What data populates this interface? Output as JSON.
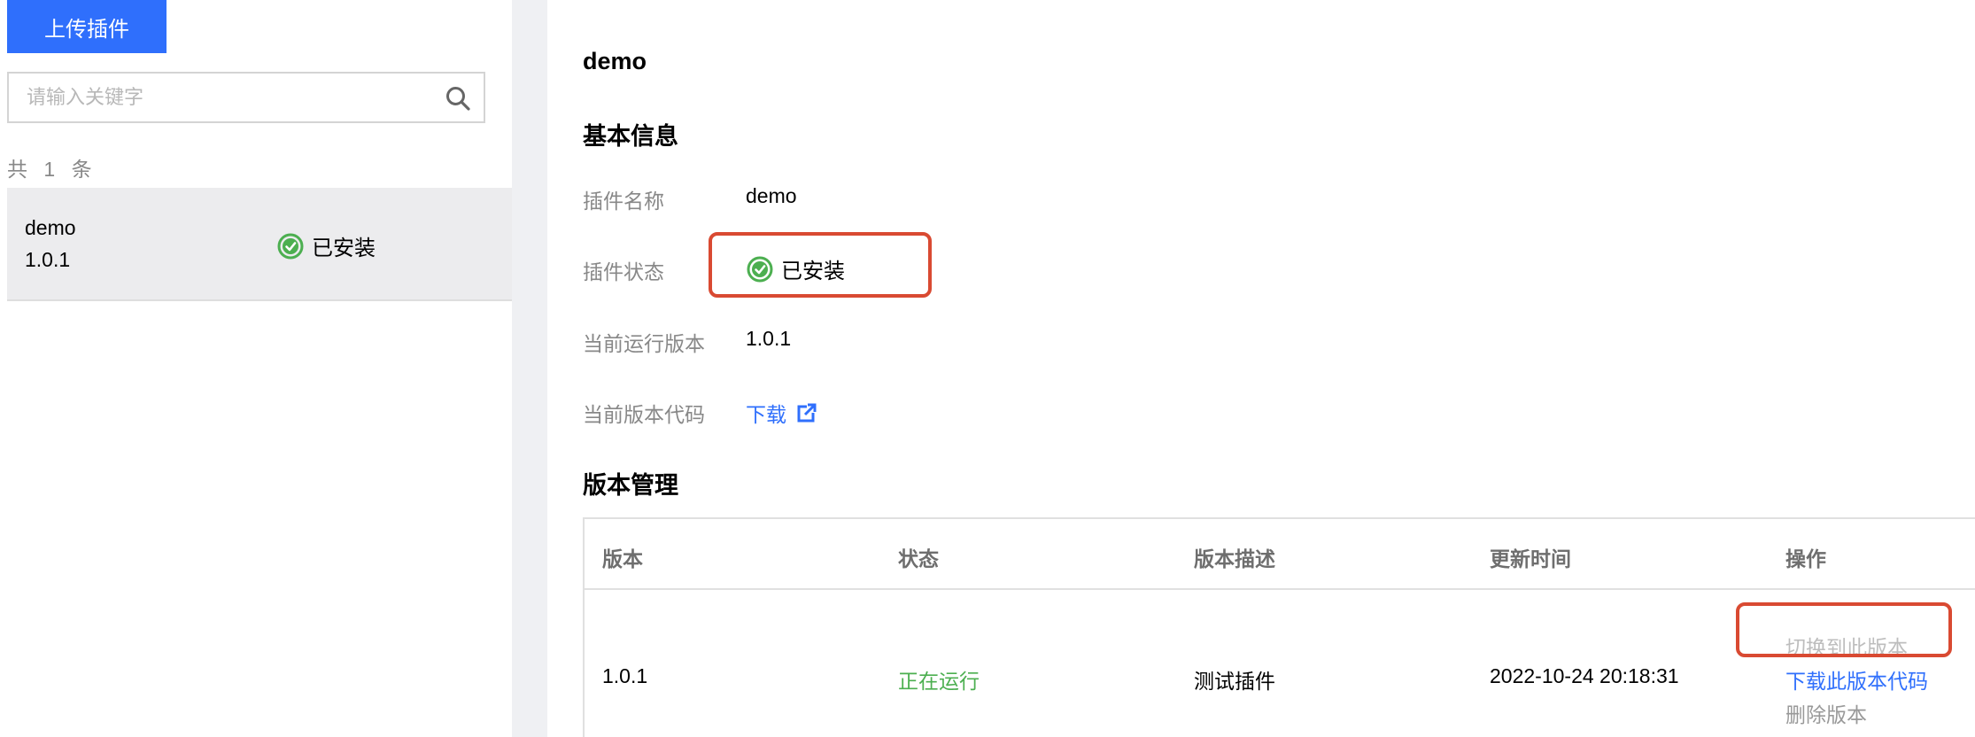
{
  "sidebar": {
    "upload_button": "上传插件",
    "search_placeholder": "请输入关键字",
    "count_text": "共 1 条",
    "items": [
      {
        "name": "demo",
        "version": "1.0.1",
        "status": "已安装"
      }
    ]
  },
  "detail": {
    "title": "demo",
    "basic_info_title": "基本信息",
    "fields": {
      "name_label": "插件名称",
      "name_value": "demo",
      "status_label": "插件状态",
      "status_value": "已安装",
      "running_version_label": "当前运行版本",
      "running_version_value": "1.0.1",
      "code_label": "当前版本代码",
      "code_link": "下载"
    },
    "version_mgmt_title": "版本管理",
    "table": {
      "headers": [
        "版本",
        "状态",
        "版本描述",
        "更新时间",
        "操作"
      ],
      "rows": [
        {
          "version": "1.0.1",
          "status": "正在运行",
          "description": "测试插件",
          "updated": "2022-10-24 20:18:31",
          "actions": [
            "切换到此版本",
            "下载此版本代码",
            "删除版本"
          ]
        }
      ]
    }
  },
  "colors": {
    "primary": "#2f6ffc",
    "success": "#4caf50",
    "highlight": "#d94a32"
  }
}
